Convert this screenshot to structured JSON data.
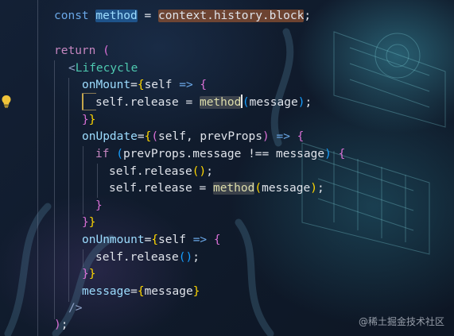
{
  "code": {
    "line1": {
      "kw": "const",
      "var": "method",
      "op": " = ",
      "obj": "context.history.block",
      "end": ";"
    },
    "line2": {
      "kw": "return",
      "paren": "("
    },
    "line3": {
      "open": "<",
      "tag": "Lifecycle"
    },
    "line4": {
      "attr": "onMount",
      "eq": "=",
      "b1": "{",
      "param": "self",
      "arrow": " => ",
      "b2": "{"
    },
    "line5": {
      "obj": "self.release",
      "eq": " = ",
      "fn": "method",
      "p1": "(",
      "arg": "message",
      "p2": ")",
      "end": ";"
    },
    "line6": {
      "b2": "}",
      "b1": "}"
    },
    "line7": {
      "attr": "onUpdate",
      "eq": "=",
      "b1": "{",
      "p1": "(",
      "params": "self, prevProps",
      "p2": ")",
      "arrow": " => ",
      "b2": "{"
    },
    "line8": {
      "kw": "if",
      "p1": " (",
      "cond": "prevProps.message !== message",
      "p2": ")",
      "b3": " {"
    },
    "line9": {
      "obj": "self.release",
      "call": "()",
      "end": ";"
    },
    "line10": {
      "obj": "self.release",
      "eq": " = ",
      "fn": "method",
      "p1": "(",
      "arg": "message",
      "p2": ")",
      "end": ";"
    },
    "line11": {
      "b3": "}"
    },
    "line12": {
      "b2": "}",
      "b1": "}"
    },
    "line13": {
      "attr": "onUnmount",
      "eq": "=",
      "b1": "{",
      "param": "self",
      "arrow": " => ",
      "b2": "{"
    },
    "line14": {
      "obj": "self.release",
      "call": "()",
      "end": ";"
    },
    "line15": {
      "b2": "}",
      "b1": "}"
    },
    "line16": {
      "attr": "message",
      "eq": "=",
      "b1": "{",
      "val": "message",
      "b1c": "}"
    },
    "line17": {
      "close": "/>"
    },
    "line18": {
      "paren": ")",
      "end": ";"
    }
  },
  "watermark": "@稀土掘金技术社区",
  "icons": {
    "lightbulb": "lightbulb-icon"
  },
  "colors": {
    "keyword": "#c586c0",
    "variable": "#9cdcfe",
    "function": "#dcdcaa",
    "tag": "#4ec9b0",
    "bracket1": "#ffd700",
    "bracket2": "#da70d6",
    "bracket3": "#179fff"
  }
}
